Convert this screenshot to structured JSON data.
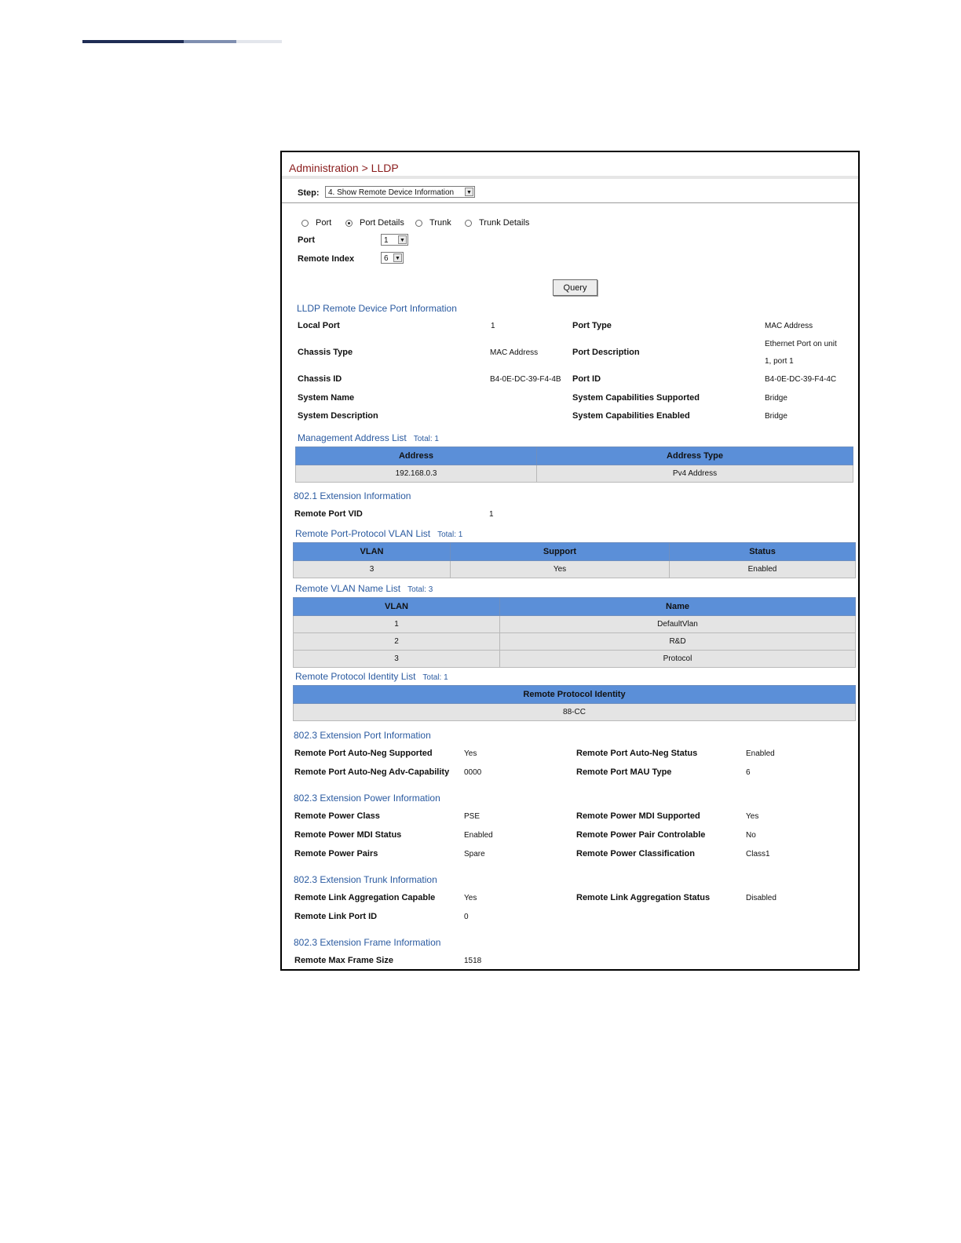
{
  "breadcrumb": {
    "text": "Administration > LLDP"
  },
  "step": {
    "label": "Step:",
    "selected": "4. Show Remote Device Information"
  },
  "scope_radios": [
    {
      "label": "Port",
      "checked": false
    },
    {
      "label": "Port Details",
      "checked": true
    },
    {
      "label": "Trunk",
      "checked": false
    },
    {
      "label": "Trunk Details",
      "checked": false
    }
  ],
  "filters": {
    "port_label": "Port",
    "port_value": "1",
    "remote_index_label": "Remote Index",
    "remote_index_value": "6"
  },
  "query_button": "Query",
  "remote_port_info": {
    "heading": "LLDP Remote Device Port Information",
    "local_port_label": "Local Port",
    "local_port": "1",
    "port_type_label": "Port Type",
    "port_type": "MAC Address",
    "chassis_type_label": "Chassis Type",
    "chassis_type": "MAC Address",
    "port_description_label": "Port Description",
    "port_description_line1": "Ethernet Port on unit",
    "port_description_line2": "1, port 1",
    "chassis_id_label": "Chassis ID",
    "chassis_id": "B4-0E-DC-39-F4-4B",
    "port_id_label": "Port ID",
    "port_id": "B4-0E-DC-39-F4-4C",
    "system_name_label": "System Name",
    "sys_cap_supported_label": "System Capabilities Supported",
    "sys_cap_supported": "Bridge",
    "system_description_label": "System Description",
    "sys_cap_enabled_label": "System Capabilities Enabled",
    "sys_cap_enabled": "Bridge"
  },
  "mgmt_address_list": {
    "heading": "Management Address List",
    "total": "Total: 1",
    "columns": [
      "Address",
      "Address Type"
    ],
    "rows": [
      [
        "192.168.0.3",
        "Pv4 Address"
      ]
    ]
  },
  "ext_8021": {
    "heading": "802.1 Extension Information",
    "remote_port_vid_label": "Remote Port VID",
    "remote_port_vid": "1"
  },
  "ppvlan_list": {
    "heading": "Remote Port-Protocol VLAN List",
    "total": "Total: 1",
    "columns": [
      "VLAN",
      "Support",
      "Status"
    ],
    "rows": [
      [
        "3",
        "Yes",
        "Enabled"
      ]
    ]
  },
  "vlan_name_list": {
    "heading": "Remote VLAN Name List",
    "total": "Total: 3",
    "columns": [
      "VLAN",
      "Name"
    ],
    "rows": [
      [
        "1",
        "DefaultVlan"
      ],
      [
        "2",
        "R&D"
      ],
      [
        "3",
        "Protocol"
      ]
    ]
  },
  "protocol_identity_list": {
    "heading": "Remote Protocol Identity List",
    "total": "Total: 1",
    "columns": [
      "Remote Protocol Identity"
    ],
    "rows": [
      [
        "88-CC"
      ]
    ]
  },
  "ext_8023_port": {
    "heading": "802.3 Extension Port Information",
    "autoneg_supported_label": "Remote Port Auto-Neg Supported",
    "autoneg_supported": "Yes",
    "autoneg_status_label": "Remote Port Auto-Neg Status",
    "autoneg_status": "Enabled",
    "autoneg_adv_label": "Remote Port Auto-Neg Adv-Capability",
    "autoneg_adv": "0000",
    "mau_type_label": "Remote Port MAU Type",
    "mau_type": "6"
  },
  "ext_8023_power": {
    "heading": "802.3 Extension Power Information",
    "power_class_label": "Remote Power Class",
    "power_class": "PSE",
    "mdi_supported_label": "Remote Power MDI Supported",
    "mdi_supported": "Yes",
    "mdi_status_label": "Remote Power MDI Status",
    "mdi_status": "Enabled",
    "pair_controlable_label": "Remote Power Pair Controlable",
    "pair_controlable": "No",
    "power_pairs_label": "Remote Power Pairs",
    "power_pairs": "Spare",
    "classification_label": "Remote Power Classification",
    "classification": "Class1"
  },
  "ext_8023_trunk": {
    "heading": "802.3 Extension Trunk Information",
    "agg_capable_label": "Remote Link Aggregation Capable",
    "agg_capable": "Yes",
    "agg_status_label": "Remote Link Aggregation Status",
    "agg_status": "Disabled",
    "link_port_id_label": "Remote Link Port ID",
    "link_port_id": "0"
  },
  "ext_8023_frame": {
    "heading": "802.3 Extension Frame Information",
    "max_frame_label": "Remote Max Frame Size",
    "max_frame": "1518"
  }
}
